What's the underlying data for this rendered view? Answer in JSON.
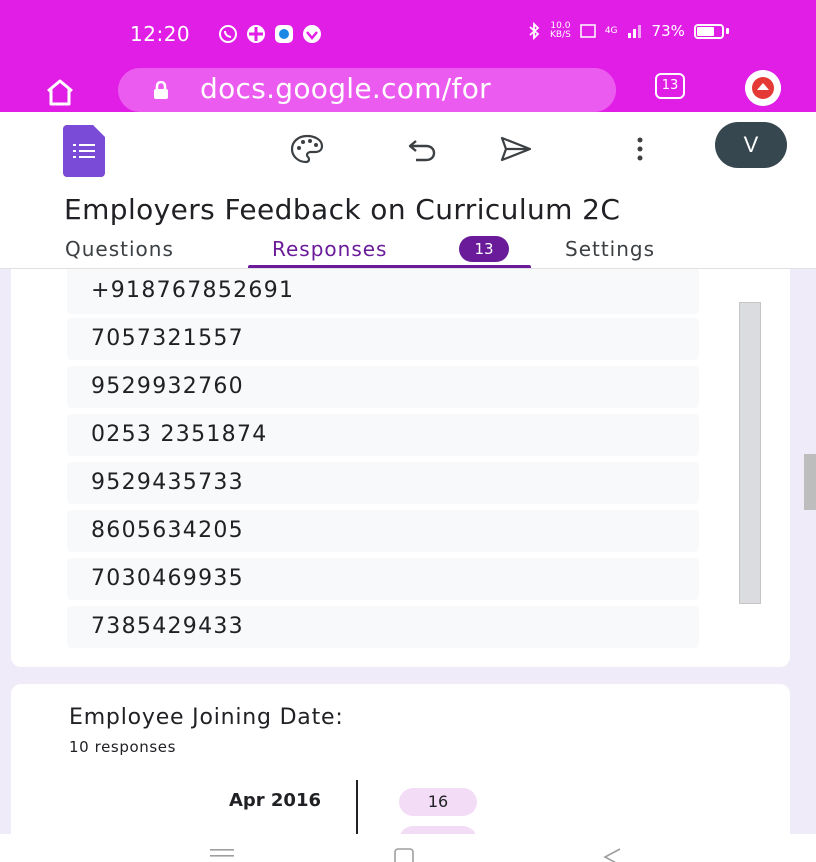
{
  "status_bar": {
    "time": "12:20",
    "net_speed_value": "10.0",
    "net_speed_unit": "KB/S",
    "network": "4G",
    "battery": "73%",
    "battery_level": 0.73,
    "notification_icons": [
      "whatsapp-icon",
      "app-icon",
      "messenger-icon",
      "vpn-icon"
    ]
  },
  "browser": {
    "url": "docs.google.com/for",
    "tab_count": "13"
  },
  "app_bar": {
    "avatar_initial": "V",
    "icons": [
      "palette-icon",
      "undo-icon",
      "send-icon",
      "more-vert-icon"
    ]
  },
  "form": {
    "title": "Employers Feedback on Curriculum 2C"
  },
  "tabs": {
    "questions": "Questions",
    "responses": "Responses",
    "responses_count": "13",
    "settings": "Settings",
    "active": "Responses"
  },
  "answers": [
    "+918767852691",
    "7057321557",
    "9529932760",
    "0253 2351874",
    "9529435733",
    "8605634205",
    "7030469935",
    "7385429433"
  ],
  "question2": {
    "title": "Employee Joining Date:",
    "responses": "10 responses",
    "dates": [
      {
        "label": "Apr 2016",
        "values": [
          "16"
        ]
      }
    ]
  },
  "colors": {
    "browser_chrome": "#e11ee6",
    "accent": "#6a1b9a",
    "forms_brand": "#7a4bd6",
    "page_bg": "#f0ebf8"
  }
}
